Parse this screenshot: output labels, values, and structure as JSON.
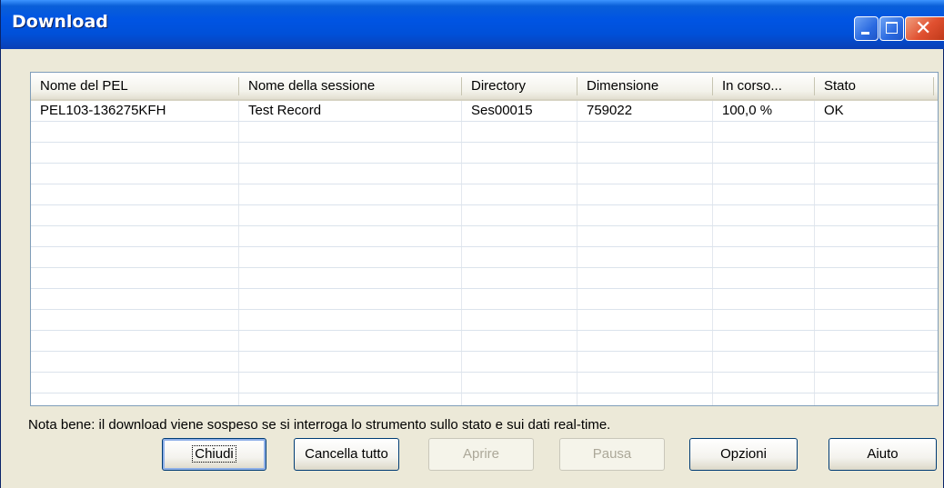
{
  "window": {
    "title": "Download"
  },
  "list": {
    "columns": [
      "Nome del PEL",
      "Nome della sessione",
      "Directory",
      "Dimensione",
      "In corso...",
      "Stato"
    ],
    "rows": [
      [
        "PEL103-136275KFH",
        "Test Record",
        "Ses00015",
        "759022",
        "100,0 %",
        "OK"
      ]
    ]
  },
  "note": "Nota bene: il download viene sospeso se si interroga lo strumento sullo stato e sui dati real-time.",
  "buttons": {
    "close": "Chiudi",
    "clear_all": "Cancella tutto",
    "open": "Aprire",
    "pause": "Pausa",
    "options": "Opzioni",
    "help": "Aiuto"
  },
  "colors": {
    "titlebar": "#0054e3",
    "close_button": "#e05030",
    "dialog_bg": "#ece9d8"
  }
}
